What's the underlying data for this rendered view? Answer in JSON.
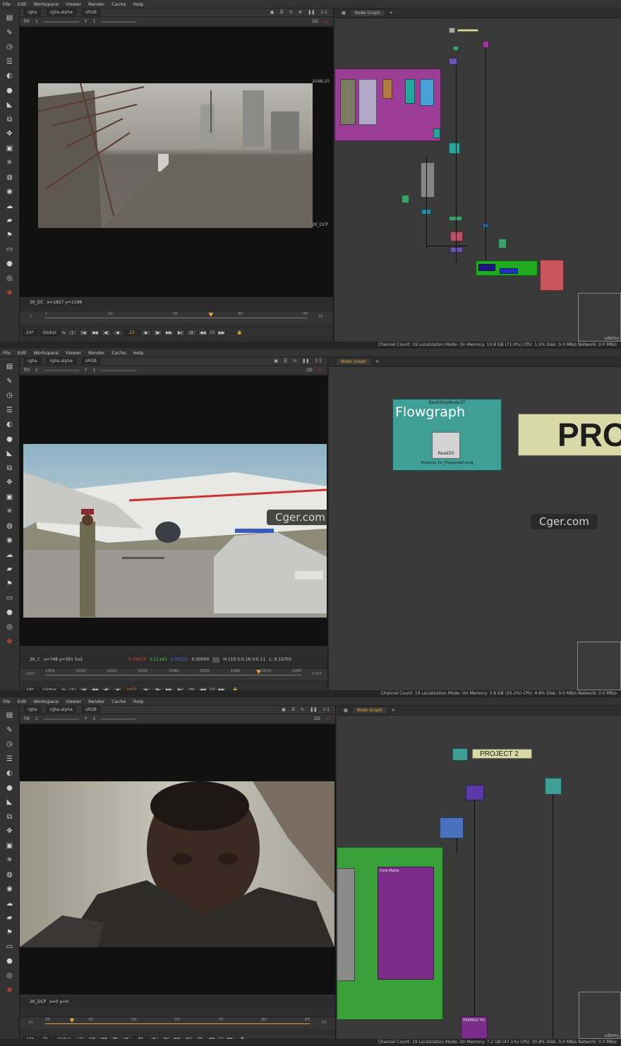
{
  "menu": [
    "File",
    "Edit",
    "Workspace",
    "Viewer",
    "Render",
    "Cache",
    "Help"
  ],
  "toolbar_icons": [
    "toolsets-icon",
    "paint-brush-icon",
    "clock-icon",
    "channel-icon",
    "color-wheel-icon",
    "filter-circle-icon",
    "keyer-icon",
    "merge-icon",
    "transform-icon",
    "3d-cube-icon",
    "particles-icon",
    "deep-icon",
    "views-icon",
    "metadata-icon",
    "toolsets-folder-icon",
    "furnace-icon",
    "other-icon",
    "cara-icon",
    "nukex-icon",
    "plugins-icon"
  ],
  "node_graph_tab": "Node Graph",
  "panels": [
    {
      "viewer": {
        "channels": "rgba",
        "alpha": "rgba.alpha",
        "lut": "sRGB",
        "fstop": "f/0",
        "gain": "1",
        "y_label": "Y",
        "gamma": "1",
        "view_mode": "2D",
        "zoom": "1:1",
        "format_label": "2048,10",
        "format_bottom": "2K_DCP",
        "status_format": "2K_DC",
        "status_coords": "x=1827 y=1196",
        "timeline": {
          "start": "1",
          "end": "35",
          "ticks": [
            "1",
            "10",
            "20",
            "30",
            "35"
          ],
          "current": "23",
          "head_frac": 0.63
        },
        "fps": "24*",
        "scope": "Global",
        "current_frame": "23",
        "step": "10"
      },
      "status": "Channel Count: 19  Localization Mode: On  Memory: 10.8 GB (71.0%)  CPU: 1.5%  Disk: 0.0 MB/s  Network: 0.0 MB/s",
      "minimap_label": "udemy"
    },
    {
      "viewer": {
        "channels": "rgba",
        "alpha": "rgba.alpha",
        "lut": "sRGB",
        "fstop": "f/0",
        "gain": "1",
        "y_label": "Y",
        "gamma": "1",
        "view_mode": "2D",
        "zoom": "1:1",
        "status_format": "2K_C",
        "status_coords": "x=748 y=591 5x2",
        "status_r": "0.09619",
        "status_g": "0.11163",
        "status_b": "0.09222",
        "status_a": "0.00000",
        "status_hsv": "H:110 S:0.16 V:0.11",
        "status_l": "L: 0.10702",
        "timeline": {
          "start": "1001",
          "end": "1085",
          "ticks": [
            "1001",
            "1010",
            "1020",
            "1030",
            "1040",
            "1050",
            "1060",
            "1070",
            "1085"
          ],
          "current": "1071",
          "head_frac": 0.83
        },
        "fps": "24*",
        "scope": "Global",
        "current_frame": "1071",
        "step": "10"
      },
      "backdrop_label": "BackdropNode37",
      "backdrop_title": "Flowgraph",
      "read_node": "Read20",
      "read_file": "Projects 1e_Flowgraph.png",
      "big_title": "PRO",
      "watermarks": [
        "Cger.com",
        "Cger.com"
      ],
      "status": "Channel Count: 19  Localization Mode: On  Memory: 3.8 GB (25.2%)  CPU: 4.6%  Disk: 0.0 MB/s  Network: 0.0 MB/s"
    },
    {
      "viewer": {
        "channels": "rgba",
        "alpha": "rgba.alpha",
        "lut": "sRGB",
        "fstop": "f/8",
        "gain": "1",
        "y_label": "Y",
        "gamma": "1",
        "view_mode": "2D",
        "zoom": "1:1",
        "status_format": "2K_DCP",
        "status_coords": "x=0 y=0",
        "timeline": {
          "start": "35",
          "end": "85",
          "ticks": [
            "35",
            "40",
            "50",
            "60",
            "70",
            "80",
            "85"
          ],
          "current": "40",
          "head_frac": 0.1
        },
        "fps": "24*",
        "scope": "Global",
        "mode": "TF",
        "current_frame": "40",
        "step": "10"
      },
      "project_label": "PROJECT 2",
      "group_label": "Core Matte",
      "bottom_node": "PREMULT FG",
      "status": "Channel Count: 19  Localization Mode: On  Memory: 7.2 GB (47.1%)  CPU: 30.8%  Disk: 0.0 MB/s  Network: 0.0 MB/s",
      "minimap_label": "udemy"
    }
  ]
}
